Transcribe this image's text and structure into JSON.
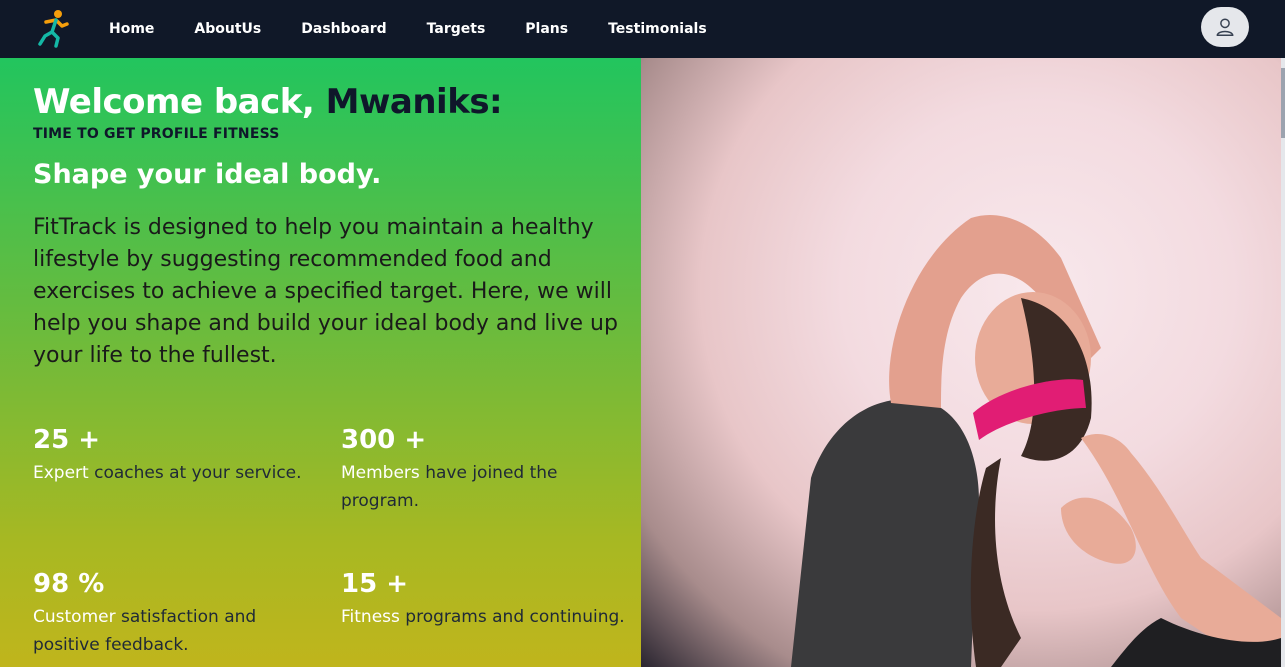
{
  "nav": {
    "items": [
      {
        "label": "Home"
      },
      {
        "label": "AboutUs"
      },
      {
        "label": "Dashboard"
      },
      {
        "label": "Targets"
      },
      {
        "label": "Plans"
      },
      {
        "label": "Testimonials"
      }
    ],
    "logo_icon": "running-man-icon",
    "avatar_icon": "user-icon"
  },
  "hero": {
    "welcome_prefix": "Welcome back,",
    "username": "Mwaniks:",
    "tagline": "TIME TO GET PROFILE FITNESS",
    "headline": "Shape your ideal body.",
    "description": "FitTrack is designed to help you maintain a healthy lifestyle by suggesting recommended food and exercises to achieve a specified target. Here, we will help you shape and build your ideal body and live up your life to the fullest."
  },
  "stats": [
    {
      "value": "25 +",
      "highlight": "Expert",
      "text": "coaches at your service."
    },
    {
      "value": "300 +",
      "highlight": "Members",
      "text": "have joined the program."
    },
    {
      "value": "98 %",
      "highlight": "Customer",
      "text": "satisfaction and positive feedback."
    },
    {
      "value": "15 +",
      "highlight": "Fitness",
      "text": "programs and continuing."
    }
  ],
  "colors": {
    "navbar": "#101828",
    "gradient_top": "#22c55e",
    "gradient_bottom": "#c0b51c",
    "accent_orange": "#f59e0b",
    "accent_teal": "#14b8a6",
    "headband_pink": "#e11d74"
  }
}
